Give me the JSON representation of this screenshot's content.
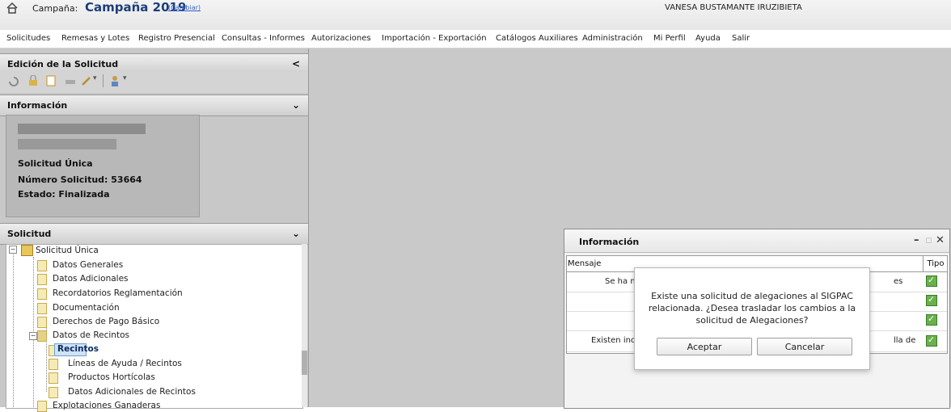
{
  "header": {
    "campaign_label": "Campaña:",
    "campaign_name": "Campaña 2019",
    "change_link": "(Cambiar)",
    "user": "VANESA BUSTAMANTE IRUZIBIETA"
  },
  "menu": [
    "Solicitudes",
    "Remesas y Lotes",
    "Registro Presencial",
    "Consultas - Informes",
    "Autorizaciones",
    "Importación - Exportación",
    "Catálogos Auxiliares",
    "Administración",
    "Mi Perfil",
    "Ayuda",
    "Salir"
  ],
  "left": {
    "edit_title": "Edición de la Solicitud",
    "edit_arrow": "<",
    "info_title": "Información",
    "info_arrow": "⌄",
    "info": {
      "type": "Solicitud Única",
      "number": "Número Solicitud: 53664",
      "state": "Estado: Finalizada"
    },
    "solicitud_title": "Solicitud",
    "solicitud_arrow": "⌄",
    "tree": [
      "Solicitud Única",
      "Datos Generales",
      "Datos Adicionales",
      "Recordatorios Reglamentación",
      "Documentación",
      "Derechos de Pago Básico",
      "Datos de Recintos",
      "Recintos",
      "Líneas de Ayuda / Recintos",
      "Productos Hortícolas",
      "Datos Adicionales de Recintos",
      "Explotaciones Ganaderas"
    ]
  },
  "infowin": {
    "title": "Información",
    "col_msg": "Mensaje",
    "col_type": "Tipo",
    "rows": [
      {
        "left": "Se ha m",
        "right": "es"
      },
      {
        "left": "",
        "right": ""
      },
      {
        "left": "",
        "right": ""
      },
      {
        "left": "Existen inci",
        "right": "lla de"
      }
    ]
  },
  "dialog": {
    "message": "Existe una solicitud de alegaciones al SIGPAC relacionada. ¿Desea trasladar los cambios a la solicitud de Alegaciones?",
    "accept": "Aceptar",
    "cancel": "Cancelar"
  }
}
